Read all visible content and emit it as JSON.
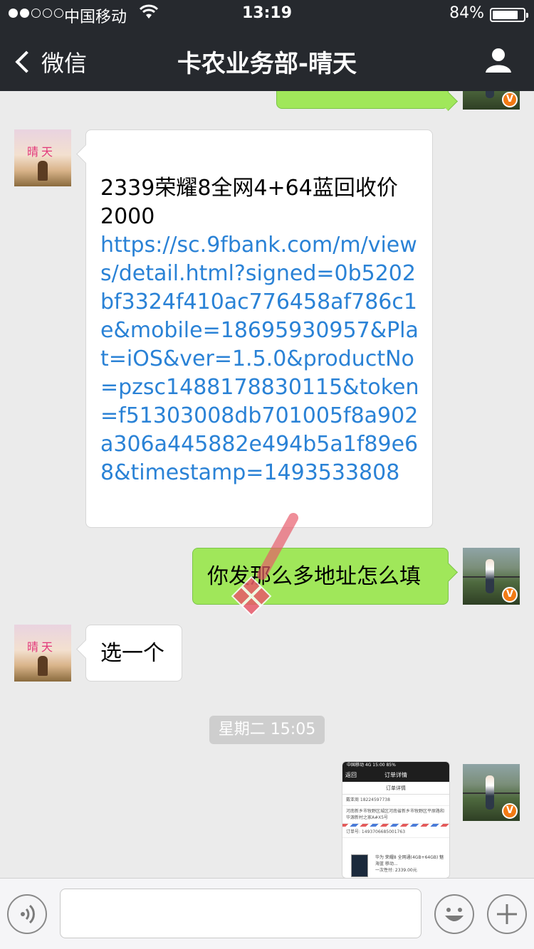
{
  "status_bar": {
    "carrier": "中国移动",
    "time": "13:19",
    "battery_percent": "84%",
    "battery_level": 0.84,
    "signal_bars_filled": 2,
    "signal_bars_total": 5
  },
  "nav": {
    "back_label": "微信",
    "title": "卡农业务部-晴天"
  },
  "avatars": {
    "contact_avatar_text": "晴天",
    "me_badge": "V"
  },
  "messages": [
    {
      "side": "left",
      "text": "2339荣耀8全网4+64蓝回收价2000",
      "link": "https://sc.9fbank.com/m/views/detail.html?signed=0b5202bf3324f410ac776458af786c1e&mobile=18695930957&Plat=iOS&ver=1.5.0&productNo=pzsc1488178830115&token=f51303008db701005f8a902a306a445882e494b5a1f89e68&timestamp=1493533808"
    },
    {
      "side": "right",
      "text": "你发那么多地址怎么填"
    },
    {
      "side": "left",
      "text": "选一个"
    }
  ],
  "timestamp": "星期二 15:05",
  "image_message": {
    "status": "中国移动 4G  15:00  85%",
    "back": "返回",
    "nav_title": "订单详情",
    "header": "订单详情",
    "receiver": "戴亚周  18224597738",
    "address": "河南新乡市牧野区城区河南省新乡市牧野区平原路和华源新村之家A#X5号",
    "order_no": "订单号: 1493706685001763",
    "product": "华为 荣耀8 全网通(4GB+64GB) 魅海蓝 移动...",
    "price": "一次性付: 2339.00元"
  },
  "colors": {
    "nav_bg": "#26292e",
    "chat_bg": "#ebebeb",
    "bubble_green": "#a0e75a",
    "link_blue": "#2a82d6",
    "badge_orange": "#f27a14"
  },
  "icons": {
    "back": "chevron-left-icon",
    "profile": "person-icon",
    "voice": "voice-icon",
    "emoji": "emoji-icon",
    "plus": "plus-icon"
  }
}
